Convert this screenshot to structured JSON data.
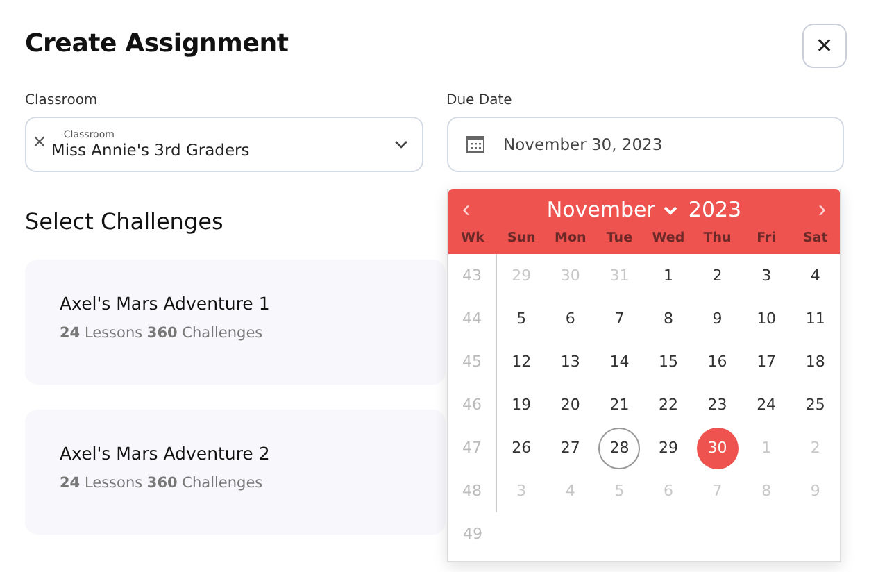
{
  "dialog": {
    "title": "Create Assignment",
    "close": "✕"
  },
  "classroom": {
    "label": "Classroom",
    "floating_label": "Classroom",
    "value": "Miss Annie's 3rd Graders",
    "clear": "×"
  },
  "due_date": {
    "label": "Due Date",
    "value": "November 30, 2023"
  },
  "section_title": "Select Challenges",
  "challenges": [
    {
      "title": "Axel's Mars Adventure 1",
      "summary": "**24** Lessons **360** Challenges"
    },
    {
      "title": "Axel's Mars Adventure 2",
      "summary": "**24** Lessons **360** Challenges"
    }
  ],
  "calendar": {
    "prev": "‹",
    "next": "›",
    "month": "November",
    "year": "2023",
    "week_header": "Wk",
    "weekdays": [
      "Sun",
      "Mon",
      "Tue",
      "Wed",
      "Thu",
      "Fri",
      "Sat"
    ],
    "weeks": [
      {
        "week": "43",
        "days": [
          {
            "label": "29",
            "outside": true,
            "today": false,
            "selected": false
          },
          {
            "label": "30",
            "outside": true,
            "today": false,
            "selected": false
          },
          {
            "label": "31",
            "outside": true,
            "today": false,
            "selected": false
          },
          {
            "label": "1",
            "outside": false,
            "today": false,
            "selected": false
          },
          {
            "label": "2",
            "outside": false,
            "today": false,
            "selected": false
          },
          {
            "label": "3",
            "outside": false,
            "today": false,
            "selected": false
          },
          {
            "label": "4",
            "outside": false,
            "today": false,
            "selected": false
          }
        ]
      },
      {
        "week": "44",
        "days": [
          {
            "label": "5",
            "outside": false,
            "today": false,
            "selected": false
          },
          {
            "label": "6",
            "outside": false,
            "today": false,
            "selected": false
          },
          {
            "label": "7",
            "outside": false,
            "today": false,
            "selected": false
          },
          {
            "label": "8",
            "outside": false,
            "today": false,
            "selected": false
          },
          {
            "label": "9",
            "outside": false,
            "today": false,
            "selected": false
          },
          {
            "label": "10",
            "outside": false,
            "today": false,
            "selected": false
          },
          {
            "label": "11",
            "outside": false,
            "today": false,
            "selected": false
          }
        ]
      },
      {
        "week": "45",
        "days": [
          {
            "label": "12",
            "outside": false,
            "today": false,
            "selected": false
          },
          {
            "label": "13",
            "outside": false,
            "today": false,
            "selected": false
          },
          {
            "label": "14",
            "outside": false,
            "today": false,
            "selected": false
          },
          {
            "label": "15",
            "outside": false,
            "today": false,
            "selected": false
          },
          {
            "label": "16",
            "outside": false,
            "today": false,
            "selected": false
          },
          {
            "label": "17",
            "outside": false,
            "today": false,
            "selected": false
          },
          {
            "label": "18",
            "outside": false,
            "today": false,
            "selected": false
          }
        ]
      },
      {
        "week": "46",
        "days": [
          {
            "label": "19",
            "outside": false,
            "today": false,
            "selected": false
          },
          {
            "label": "20",
            "outside": false,
            "today": false,
            "selected": false
          },
          {
            "label": "21",
            "outside": false,
            "today": false,
            "selected": false
          },
          {
            "label": "22",
            "outside": false,
            "today": false,
            "selected": false
          },
          {
            "label": "23",
            "outside": false,
            "today": false,
            "selected": false
          },
          {
            "label": "24",
            "outside": false,
            "today": false,
            "selected": false
          },
          {
            "label": "25",
            "outside": false,
            "today": false,
            "selected": false
          }
        ]
      },
      {
        "week": "47",
        "days": [
          {
            "label": "26",
            "outside": false,
            "today": false,
            "selected": false
          },
          {
            "label": "27",
            "outside": false,
            "today": false,
            "selected": false
          },
          {
            "label": "28",
            "outside": false,
            "today": true,
            "selected": false
          },
          {
            "label": "29",
            "outside": false,
            "today": false,
            "selected": false
          },
          {
            "label": "30",
            "outside": false,
            "today": false,
            "selected": true
          },
          {
            "label": "1",
            "outside": true,
            "today": false,
            "selected": false
          },
          {
            "label": "2",
            "outside": true,
            "today": false,
            "selected": false
          }
        ]
      },
      {
        "week": "48",
        "days": [
          {
            "label": "3",
            "outside": true,
            "today": false,
            "selected": false
          },
          {
            "label": "4",
            "outside": true,
            "today": false,
            "selected": false
          },
          {
            "label": "5",
            "outside": true,
            "today": false,
            "selected": false
          },
          {
            "label": "6",
            "outside": true,
            "today": false,
            "selected": false
          },
          {
            "label": "7",
            "outside": true,
            "today": false,
            "selected": false
          },
          {
            "label": "8",
            "outside": true,
            "today": false,
            "selected": false
          },
          {
            "label": "9",
            "outside": true,
            "today": false,
            "selected": false
          }
        ]
      },
      {
        "week": "49"
      }
    ]
  }
}
